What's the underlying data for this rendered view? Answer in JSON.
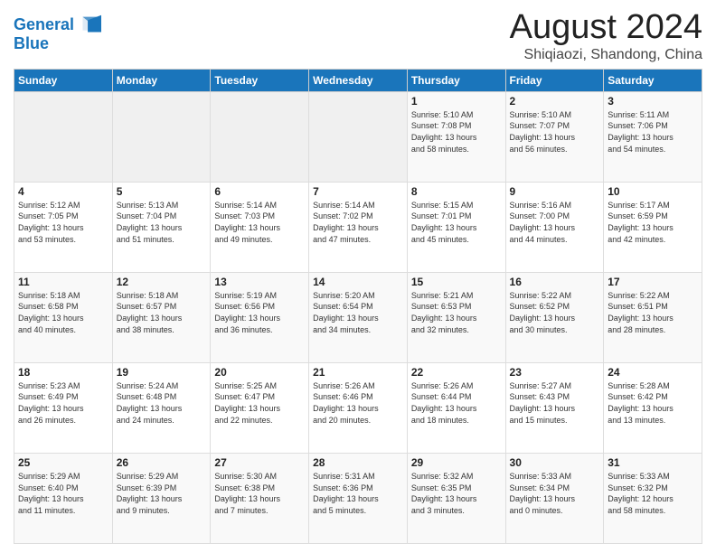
{
  "header": {
    "logo_line1": "General",
    "logo_line2": "Blue",
    "title": "August 2024",
    "subtitle": "Shiqiaozi, Shandong, China"
  },
  "weekdays": [
    "Sunday",
    "Monday",
    "Tuesday",
    "Wednesday",
    "Thursday",
    "Friday",
    "Saturday"
  ],
  "weeks": [
    [
      {
        "day": "",
        "info": ""
      },
      {
        "day": "",
        "info": ""
      },
      {
        "day": "",
        "info": ""
      },
      {
        "day": "",
        "info": ""
      },
      {
        "day": "1",
        "info": "Sunrise: 5:10 AM\nSunset: 7:08 PM\nDaylight: 13 hours\nand 58 minutes."
      },
      {
        "day": "2",
        "info": "Sunrise: 5:10 AM\nSunset: 7:07 PM\nDaylight: 13 hours\nand 56 minutes."
      },
      {
        "day": "3",
        "info": "Sunrise: 5:11 AM\nSunset: 7:06 PM\nDaylight: 13 hours\nand 54 minutes."
      }
    ],
    [
      {
        "day": "4",
        "info": "Sunrise: 5:12 AM\nSunset: 7:05 PM\nDaylight: 13 hours\nand 53 minutes."
      },
      {
        "day": "5",
        "info": "Sunrise: 5:13 AM\nSunset: 7:04 PM\nDaylight: 13 hours\nand 51 minutes."
      },
      {
        "day": "6",
        "info": "Sunrise: 5:14 AM\nSunset: 7:03 PM\nDaylight: 13 hours\nand 49 minutes."
      },
      {
        "day": "7",
        "info": "Sunrise: 5:14 AM\nSunset: 7:02 PM\nDaylight: 13 hours\nand 47 minutes."
      },
      {
        "day": "8",
        "info": "Sunrise: 5:15 AM\nSunset: 7:01 PM\nDaylight: 13 hours\nand 45 minutes."
      },
      {
        "day": "9",
        "info": "Sunrise: 5:16 AM\nSunset: 7:00 PM\nDaylight: 13 hours\nand 44 minutes."
      },
      {
        "day": "10",
        "info": "Sunrise: 5:17 AM\nSunset: 6:59 PM\nDaylight: 13 hours\nand 42 minutes."
      }
    ],
    [
      {
        "day": "11",
        "info": "Sunrise: 5:18 AM\nSunset: 6:58 PM\nDaylight: 13 hours\nand 40 minutes."
      },
      {
        "day": "12",
        "info": "Sunrise: 5:18 AM\nSunset: 6:57 PM\nDaylight: 13 hours\nand 38 minutes."
      },
      {
        "day": "13",
        "info": "Sunrise: 5:19 AM\nSunset: 6:56 PM\nDaylight: 13 hours\nand 36 minutes."
      },
      {
        "day": "14",
        "info": "Sunrise: 5:20 AM\nSunset: 6:54 PM\nDaylight: 13 hours\nand 34 minutes."
      },
      {
        "day": "15",
        "info": "Sunrise: 5:21 AM\nSunset: 6:53 PM\nDaylight: 13 hours\nand 32 minutes."
      },
      {
        "day": "16",
        "info": "Sunrise: 5:22 AM\nSunset: 6:52 PM\nDaylight: 13 hours\nand 30 minutes."
      },
      {
        "day": "17",
        "info": "Sunrise: 5:22 AM\nSunset: 6:51 PM\nDaylight: 13 hours\nand 28 minutes."
      }
    ],
    [
      {
        "day": "18",
        "info": "Sunrise: 5:23 AM\nSunset: 6:49 PM\nDaylight: 13 hours\nand 26 minutes."
      },
      {
        "day": "19",
        "info": "Sunrise: 5:24 AM\nSunset: 6:48 PM\nDaylight: 13 hours\nand 24 minutes."
      },
      {
        "day": "20",
        "info": "Sunrise: 5:25 AM\nSunset: 6:47 PM\nDaylight: 13 hours\nand 22 minutes."
      },
      {
        "day": "21",
        "info": "Sunrise: 5:26 AM\nSunset: 6:46 PM\nDaylight: 13 hours\nand 20 minutes."
      },
      {
        "day": "22",
        "info": "Sunrise: 5:26 AM\nSunset: 6:44 PM\nDaylight: 13 hours\nand 18 minutes."
      },
      {
        "day": "23",
        "info": "Sunrise: 5:27 AM\nSunset: 6:43 PM\nDaylight: 13 hours\nand 15 minutes."
      },
      {
        "day": "24",
        "info": "Sunrise: 5:28 AM\nSunset: 6:42 PM\nDaylight: 13 hours\nand 13 minutes."
      }
    ],
    [
      {
        "day": "25",
        "info": "Sunrise: 5:29 AM\nSunset: 6:40 PM\nDaylight: 13 hours\nand 11 minutes."
      },
      {
        "day": "26",
        "info": "Sunrise: 5:29 AM\nSunset: 6:39 PM\nDaylight: 13 hours\nand 9 minutes."
      },
      {
        "day": "27",
        "info": "Sunrise: 5:30 AM\nSunset: 6:38 PM\nDaylight: 13 hours\nand 7 minutes."
      },
      {
        "day": "28",
        "info": "Sunrise: 5:31 AM\nSunset: 6:36 PM\nDaylight: 13 hours\nand 5 minutes."
      },
      {
        "day": "29",
        "info": "Sunrise: 5:32 AM\nSunset: 6:35 PM\nDaylight: 13 hours\nand 3 minutes."
      },
      {
        "day": "30",
        "info": "Sunrise: 5:33 AM\nSunset: 6:34 PM\nDaylight: 13 hours\nand 0 minutes."
      },
      {
        "day": "31",
        "info": "Sunrise: 5:33 AM\nSunset: 6:32 PM\nDaylight: 12 hours\nand 58 minutes."
      }
    ]
  ]
}
